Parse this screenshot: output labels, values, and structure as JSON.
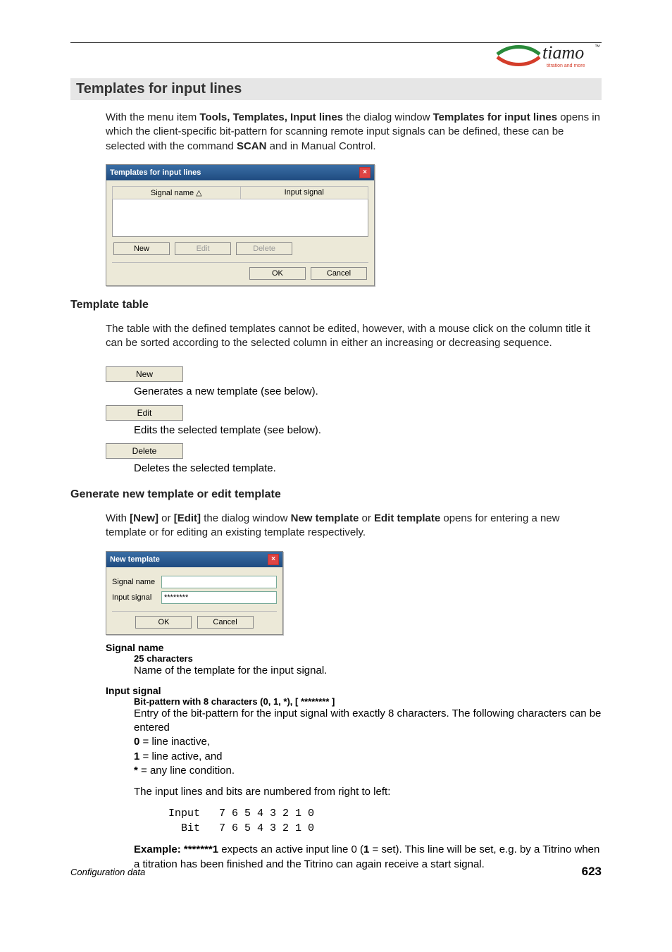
{
  "logo": {
    "brand": "tiamo",
    "tm": "™",
    "tagline": "titration and more"
  },
  "section": {
    "title": "Templates for input lines",
    "intro_pre": "With the menu item ",
    "intro_menu": "Tools, Templates, Input lines",
    "intro_mid": " the dialog window ",
    "intro_dlgname": "Templates for input lines",
    "intro_post1": " opens in which the client-specific bit-pattern for scanning remote input signals can be defined, these can be selected with the command ",
    "intro_cmd": "SCAN",
    "intro_post2": " and in Manual Control."
  },
  "dlg1": {
    "title": "Templates for input lines",
    "col1": "Signal name  △",
    "col2": "Input signal",
    "btn_new": "New",
    "btn_edit": "Edit",
    "btn_delete": "Delete",
    "btn_ok": "OK",
    "btn_cancel": "Cancel"
  },
  "template_table": {
    "heading": "Template table",
    "para": "The table with the defined templates cannot be edited, however, with a mouse click on the column title it can be sorted according to the selected column in either an increasing or decreasing sequence.",
    "new_label": "New",
    "new_desc": "Generates a new template (see below).",
    "edit_label": "Edit",
    "edit_desc": "Edits the selected template (see below).",
    "delete_label": "Delete",
    "delete_desc": "Deletes the selected template."
  },
  "generate": {
    "heading": "Generate new template or edit template",
    "para_pre": "With ",
    "bnew": "[New]",
    "or": " or ",
    "bedit": "[Edit]",
    "mid": " the dialog window ",
    "newt": "New template",
    "or2": " or ",
    "editt": "Edit template",
    "post": " opens for entering a new template or for editing an existing template respectively."
  },
  "dlg2": {
    "title": "New template",
    "lbl_signal": "Signal name",
    "lbl_input": "Input signal",
    "val_input": "********",
    "btn_ok": "OK",
    "btn_cancel": "Cancel"
  },
  "fields": {
    "sig_term": "Signal name",
    "sig_sub": "25 characters",
    "sig_body": "Name of the template for the input signal.",
    "inp_term": "Input signal",
    "inp_sub": "Bit-pattern with 8 characters (0, 1, *), [ ******** ]",
    "inp_body1": "Entry of the bit-pattern for the input signal with exactly 8 characters. The following characters can be entered",
    "line0a": "0",
    "line0b": " = line inactive,",
    "line1a": "1",
    "line1b": " = line active, and",
    "line2a": "*",
    "line2b": " = any line condition.",
    "numbered": "The input lines and bits are numbered from right to left:",
    "mono": " Input   7 6 5 4 3 2 1 0\n   Bit   7 6 5 4 3 2 1 0",
    "ex_label": "Example: ",
    "ex_pat": "*******1",
    "ex_mid": " expects an active input line 0 (",
    "ex_one": "1",
    "ex_post": " = set). This line will be set, e.g. by a Titrino when a titration has been finished and the Titrino can again receive a start signal."
  },
  "footer": {
    "left": "Configuration data",
    "right": "623"
  }
}
